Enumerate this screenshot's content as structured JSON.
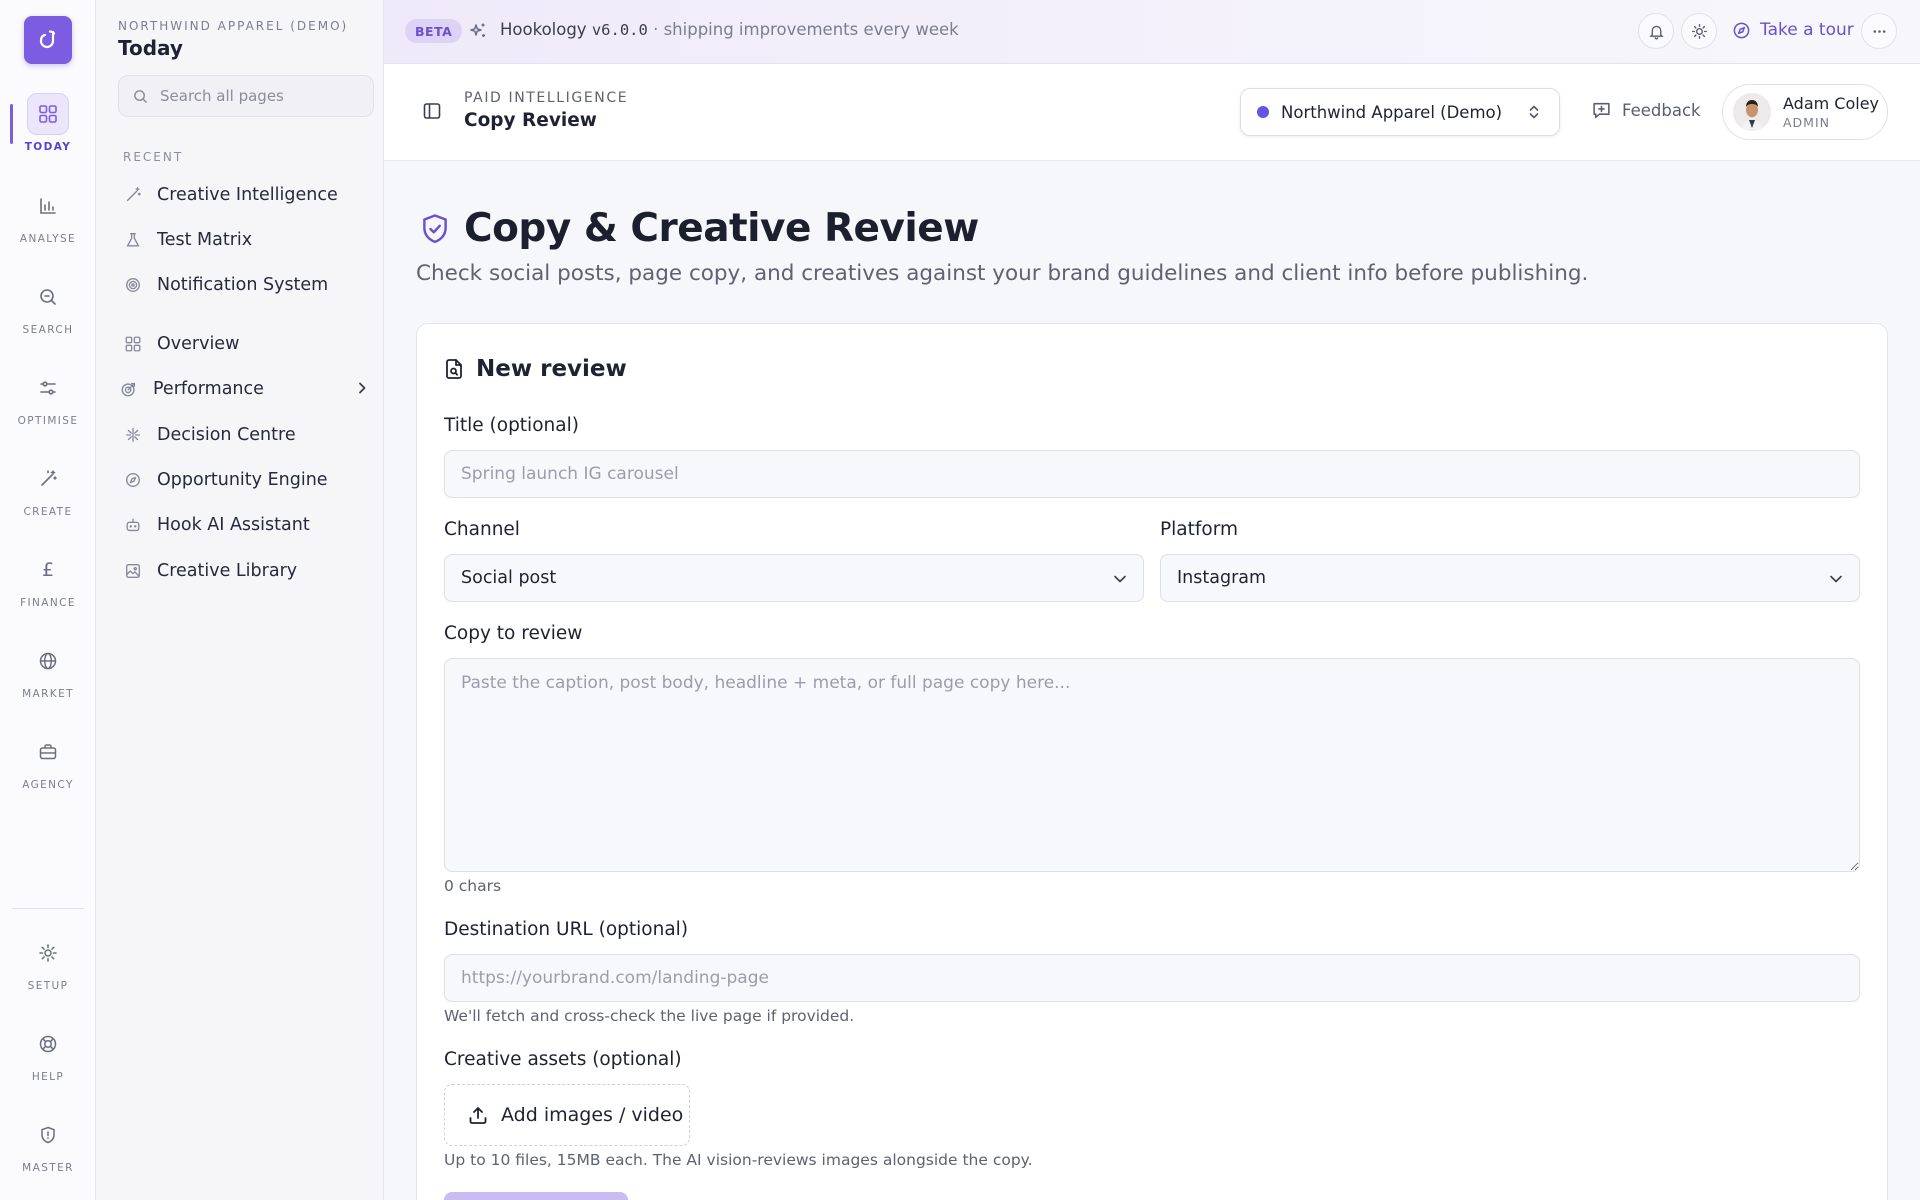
{
  "rail": {
    "logo_icon": "brand-logo-icon",
    "items": [
      {
        "label": "TODAY",
        "icon": "grid-icon",
        "active": true
      },
      {
        "label": "ANALYSE",
        "icon": "bar-chart-icon"
      },
      {
        "label": "SEARCH",
        "icon": "search-icon"
      },
      {
        "label": "OPTIMISE",
        "icon": "sliders-icon"
      },
      {
        "label": "CREATE",
        "icon": "magic-wand-icon"
      },
      {
        "label": "FINANCE",
        "icon": "pound-icon"
      },
      {
        "label": "MARKET",
        "icon": "globe-icon"
      },
      {
        "label": "AGENCY",
        "icon": "briefcase-icon"
      }
    ],
    "bottom_items": [
      {
        "label": "SETUP",
        "icon": "gear-icon"
      },
      {
        "label": "HELP",
        "icon": "lifebuoy-icon"
      },
      {
        "label": "MASTER",
        "icon": "shield-icon"
      }
    ]
  },
  "sidebar": {
    "org": "NORTHWIND APPAREL (DEMO)",
    "title": "Today",
    "search_placeholder": "Search all pages",
    "recent_label": "RECENT",
    "recent": [
      {
        "label": "Creative Intelligence",
        "icon": "magic-wand-icon"
      },
      {
        "label": "Test Matrix",
        "icon": "flask-icon"
      },
      {
        "label": "Notification System",
        "icon": "target-icon"
      }
    ],
    "items": [
      {
        "label": "Overview",
        "icon": "grid-icon"
      },
      {
        "label": "Performance",
        "icon": "target-arrow-icon",
        "has_children": true
      },
      {
        "label": "Decision Centre",
        "icon": "split-icon"
      },
      {
        "label": "Opportunity Engine",
        "icon": "compass-icon"
      },
      {
        "label": "Hook AI Assistant",
        "icon": "bot-icon"
      },
      {
        "label": "Creative Library",
        "icon": "images-icon"
      }
    ]
  },
  "banner": {
    "badge": "BETA",
    "app_name": "Hookology",
    "version": "v6.0.0",
    "separator": "·",
    "tagline": "shipping improvements every week",
    "tour_label": "Take a tour"
  },
  "header": {
    "section": "PAID INTELLIGENCE",
    "page": "Copy Review",
    "org_selector": "Northwind Apparel (Demo)",
    "org_dot_color": "#6355e6",
    "feedback_label": "Feedback",
    "user_name": "Adam Coley",
    "user_role": "ADMIN"
  },
  "main": {
    "title": "Copy & Creative Review",
    "subtitle": "Check social posts, page copy, and creatives against your brand guidelines and client info before publishing.",
    "card_title": "New review",
    "form": {
      "title_label": "Title (optional)",
      "title_placeholder": "Spring launch IG carousel",
      "channel_label": "Channel",
      "channel_value": "Social post",
      "platform_label": "Platform",
      "platform_value": "Instagram",
      "copy_label": "Copy to review",
      "copy_placeholder": "Paste the caption, post body, headline + meta, or full page copy here...",
      "char_count": "0 chars",
      "url_label": "Destination URL (optional)",
      "url_placeholder": "https://yourbrand.com/landing-page",
      "url_hint": "We'll fetch and cross-check the live page if provided.",
      "assets_label": "Creative assets (optional)",
      "upload_label": "Add images / video",
      "assets_hint": "Up to 10 files, 15MB each. The AI vision-reviews images alongside the copy."
    }
  },
  "colors": {
    "accent": "#7c5ce0",
    "accent_soft": "#ebe6fb"
  }
}
